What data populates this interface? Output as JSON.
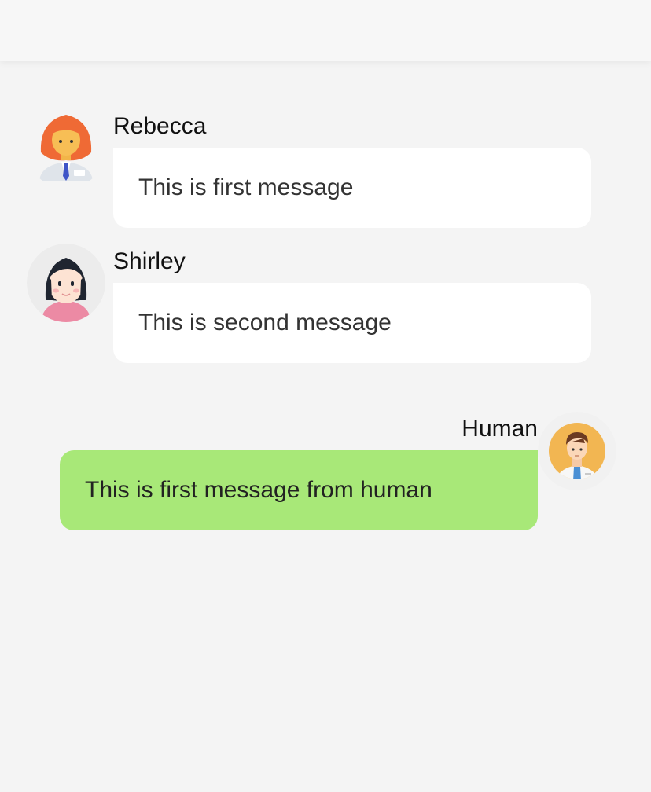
{
  "messages": [
    {
      "sender": "Rebecca",
      "text": "This is first message",
      "side": "left",
      "avatar_icon": "woman-red-hair-avatar-icon"
    },
    {
      "sender": "Shirley",
      "text": "This is second message",
      "side": "left",
      "avatar_icon": "woman-black-hair-avatar-icon"
    },
    {
      "sender": "Human",
      "text": "This is first message from human",
      "side": "right",
      "avatar_icon": "man-tie-avatar-icon"
    }
  ],
  "colors": {
    "background": "#f4f4f4",
    "incoming_bubble": "#ffffff",
    "outgoing_bubble": "#a8e878"
  }
}
